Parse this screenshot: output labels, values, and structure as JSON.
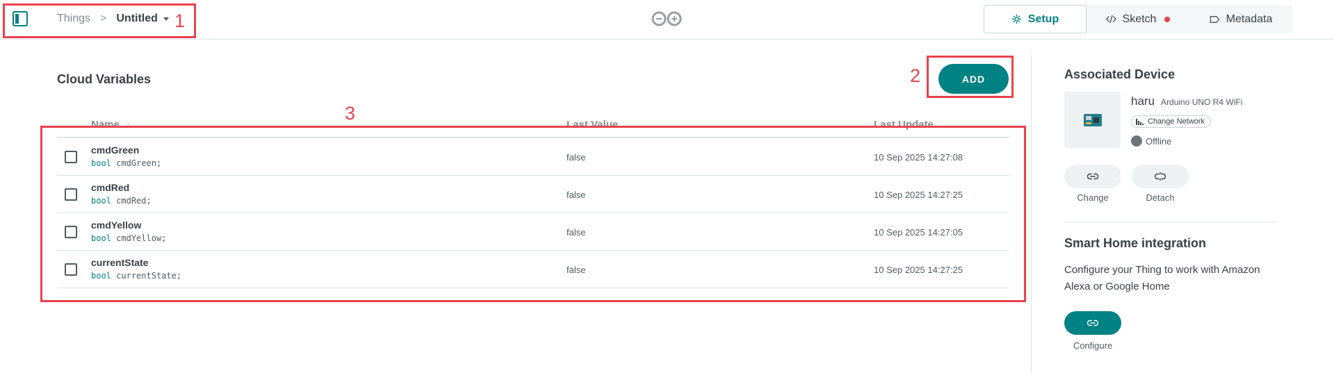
{
  "header": {
    "breadcrumb_root": "Things",
    "breadcrumb_separator": ">",
    "thing_name": "Untitled",
    "tabs": [
      {
        "label": "Setup",
        "icon": "gear-icon",
        "active": true
      },
      {
        "label": "Sketch",
        "icon": "code-icon",
        "unsaved_indicator": true
      },
      {
        "label": "Metadata",
        "icon": "tag-icon"
      }
    ]
  },
  "annotations": [
    "1",
    "2",
    "3"
  ],
  "cloud_variables": {
    "title": "Cloud Variables",
    "add_label": "ADD",
    "columns": {
      "name": "Name",
      "sort_indicator": "↓",
      "last_value": "Last Value",
      "last_update": "Last Update"
    },
    "rows": [
      {
        "name": "cmdGreen",
        "type": "bool",
        "declaration": "cmdGreen;",
        "last_value": "false",
        "last_update": "10 Sep 2025 14:27:08"
      },
      {
        "name": "cmdRed",
        "type": "bool",
        "declaration": "cmdRed;",
        "last_value": "false",
        "last_update": "10 Sep 2025 14:27:25"
      },
      {
        "name": "cmdYellow",
        "type": "bool",
        "declaration": "cmdYellow;",
        "last_value": "false",
        "last_update": "10 Sep 2025 14:27:05"
      },
      {
        "name": "currentState",
        "type": "bool",
        "declaration": "currentState;",
        "last_value": "false",
        "last_update": "10 Sep 2025 14:27:25"
      }
    ]
  },
  "associated_device": {
    "title": "Associated Device",
    "name": "haru",
    "model": "Arduino UNO R4 WiFi",
    "change_network_label": "Change Network",
    "status": "Offline",
    "change_label": "Change",
    "detach_label": "Detach"
  },
  "smart_home": {
    "title": "Smart Home integration",
    "description": "Configure your Thing to work with Amazon Alexa or Google Home",
    "configure_label": "Configure"
  },
  "colors": {
    "accent": "#008184",
    "annotation": "#e8424c",
    "unsaved_dot": "#e8424c",
    "offline": "#6b767b"
  }
}
